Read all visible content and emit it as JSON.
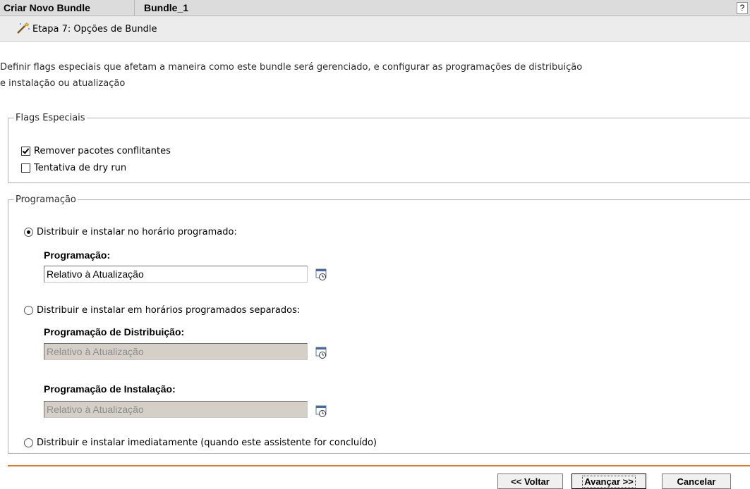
{
  "header": {
    "title": "Criar Novo Bundle",
    "bundle_name": "Bundle_1",
    "help_label": "?"
  },
  "step": {
    "icon": "wand-icon",
    "title": "Etapa 7: Opções de Bundle"
  },
  "description": {
    "line1": "Definir flags especiais que afetam a maneira como este bundle será gerenciado, e configurar as programações de distribuição",
    "line2": "e instalação ou atualização"
  },
  "flags": {
    "legend": "Flags Especiais",
    "items": [
      {
        "label": "Remover pacotes conflitantes",
        "checked": true
      },
      {
        "label": "Tentativa de dry run",
        "checked": false
      }
    ]
  },
  "schedule": {
    "legend": "Programação",
    "options": [
      {
        "label": "Distribuir e instalar no horário programado:",
        "selected": true
      },
      {
        "label": "Distribuir e instalar em horários programados separados:",
        "selected": false
      },
      {
        "label": "Distribuir e instalar imediatamente (quando este assistente for concluído)",
        "selected": false
      }
    ],
    "fields": {
      "schedule_label": "Programação:",
      "schedule_value": "Relativo à Atualização",
      "distribution_label": "Programação de Distribuição:",
      "distribution_value": "Relativo à Atualização",
      "install_label": "Programação de Instalação:",
      "install_value": "Relativo à Atualização"
    },
    "icon": "calendar-clock-icon"
  },
  "footer": {
    "back_label": "<< Voltar",
    "next_label": "Avançar >>",
    "cancel_label": "Cancelar"
  },
  "colors": {
    "accent": "#e07828",
    "header_bg": "#dcdcdc",
    "disabled_bg": "#d4d0c8"
  }
}
